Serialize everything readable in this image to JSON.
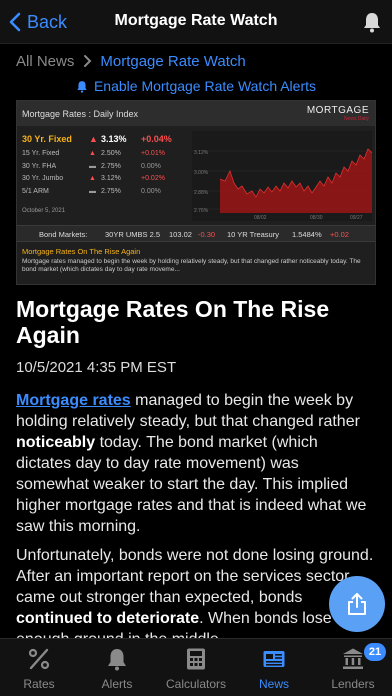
{
  "nav": {
    "back_label": "Back",
    "title": "Mortgage Rate Watch"
  },
  "breadcrumb": {
    "root": "All News",
    "current": "Mortgage Rate Watch"
  },
  "alerts_link": "Enable Mortgage Rate Watch Alerts",
  "widget": {
    "title": "Mortgage Rates : Daily Index",
    "logo_line1": "MORTGAGE",
    "logo_line2": "News Daily",
    "rows": [
      {
        "name": "30 Yr. Fixed",
        "rate": "3.13%",
        "change": "+0.04%",
        "dir": "up"
      },
      {
        "name": "15 Yr. Fixed",
        "rate": "2.50%",
        "change": "+0.01%",
        "dir": "up"
      },
      {
        "name": "30 Yr. FHA",
        "rate": "2.75%",
        "change": "0.00%",
        "dir": "flat"
      },
      {
        "name": "30 Yr. Jumbo",
        "rate": "3.12%",
        "change": "+0.02%",
        "dir": "up"
      },
      {
        "name": "5/1 ARM",
        "rate": "2.75%",
        "change": "0.00%",
        "dir": "flat"
      }
    ],
    "date": "October 5, 2021",
    "chart_y_labels": [
      "3.12%",
      "3.00%",
      "2.88%",
      "2.76%"
    ],
    "chart_x_labels": [
      "08/02",
      "08/30",
      "09/27"
    ],
    "bond_label": "Bond Markets:",
    "umbs_label": "30YR UMBS 2.5",
    "umbs_value": "103.02",
    "umbs_change": "-0.30",
    "treasury_label": "10 YR Treasury",
    "treasury_value": "1.5484%",
    "treasury_change": "+0.02",
    "news_headline": "Mortgage Rates On The Rise Again",
    "news_text": "Mortgage rates managed to begin the week by holding relatively steady, but that changed rather noticeably today. The bond market (which dictates day to day rate moveme..."
  },
  "article": {
    "headline": "Mortgage Rates On The Rise Again",
    "date": "10/5/2021 4:35 PM EST",
    "p1_link": "Mortgage rates",
    "p1_a": " managed to begin the week by holding relatively steady, but that changed rather ",
    "p1_bold": "noticeably",
    "p1_b": " today.  The bond market (which dictates day to day rate movement) was somewhat weaker to start the day.  This implied higher mortgage rates and that is indeed what we saw this morning.",
    "p2_a": "Unfortunately, bonds were not done losing ground.  After an important report on the services sector came out stronger than expected, bonds ",
    "p2_bold": "continued to deteriorate",
    "p2_b": ".  When bonds lose enough ground in the middle"
  },
  "tabs": [
    {
      "label": "Rates",
      "icon": "percent-icon"
    },
    {
      "label": "Alerts",
      "icon": "bell-icon"
    },
    {
      "label": "Calculators",
      "icon": "calculator-icon"
    },
    {
      "label": "News",
      "icon": "newspaper-icon"
    },
    {
      "label": "Lenders",
      "icon": "bank-icon",
      "badge": "21"
    }
  ],
  "colors": {
    "accent": "#3b8cff",
    "up": "#ff4d4d",
    "highlight": "#f6b21a"
  }
}
